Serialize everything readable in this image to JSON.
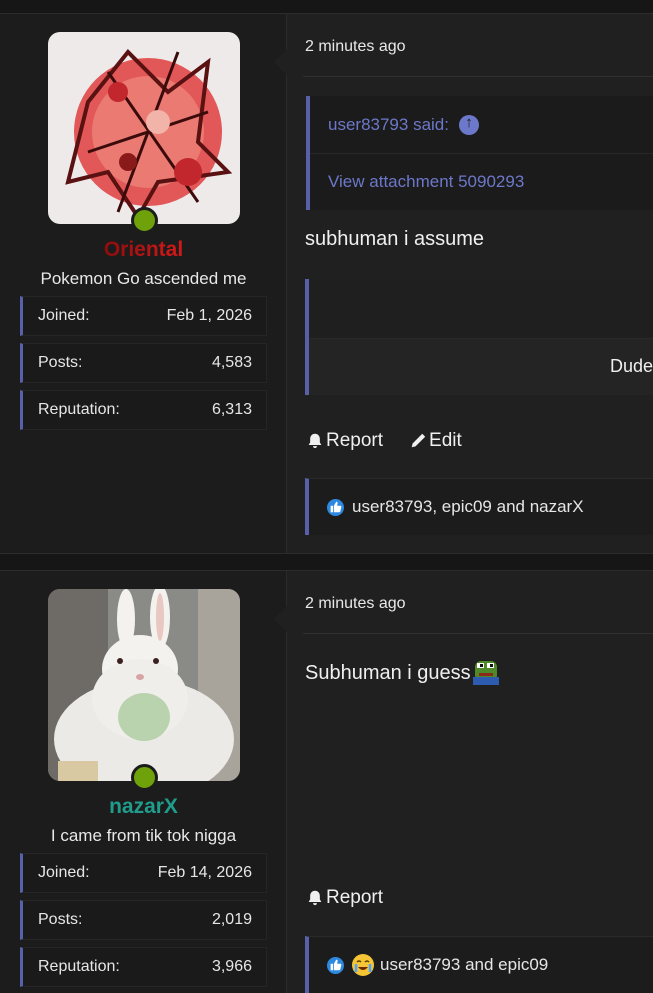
{
  "posts": [
    {
      "user": {
        "name": "Oriental",
        "title": "Pokemon Go ascended me",
        "stats": [
          {
            "label": "Joined:",
            "value": "Feb 1, 2026"
          },
          {
            "label": "Posts:",
            "value": "4,583"
          },
          {
            "label": "Reputation:",
            "value": "6,313"
          }
        ]
      },
      "time": "2 minutes ago",
      "quote": {
        "author": "user83793 said:",
        "attachment": "View attachment 5090293"
      },
      "message": "subhuman i assume",
      "embed_text": "Dude",
      "actions": {
        "report": "Report",
        "edit": "Edit"
      },
      "reactions": "user83793, epic09 and nazarX"
    },
    {
      "user": {
        "name": "nazarX",
        "title": "I came from tik tok nigga",
        "stats": [
          {
            "label": "Joined:",
            "value": "Feb 14, 2026"
          },
          {
            "label": "Posts:",
            "value": "2,019"
          },
          {
            "label": "Reputation:",
            "value": "3,966"
          }
        ]
      },
      "time": "2 minutes ago",
      "message": "Subhuman i guess",
      "actions": {
        "report": "Report"
      },
      "reactions": "user83793 and epic09"
    }
  ],
  "colors": {
    "accent": "#5760a8",
    "link": "#6c78c9",
    "online": "#6fa10b",
    "username_oriental": "#c31515",
    "username_nazarx": "#1f9c8c"
  },
  "icons": [
    "arrow-up-icon",
    "bell-icon",
    "pencil-icon",
    "like-icon",
    "crying-emoji-icon",
    "pepe-emoji-icon"
  ]
}
